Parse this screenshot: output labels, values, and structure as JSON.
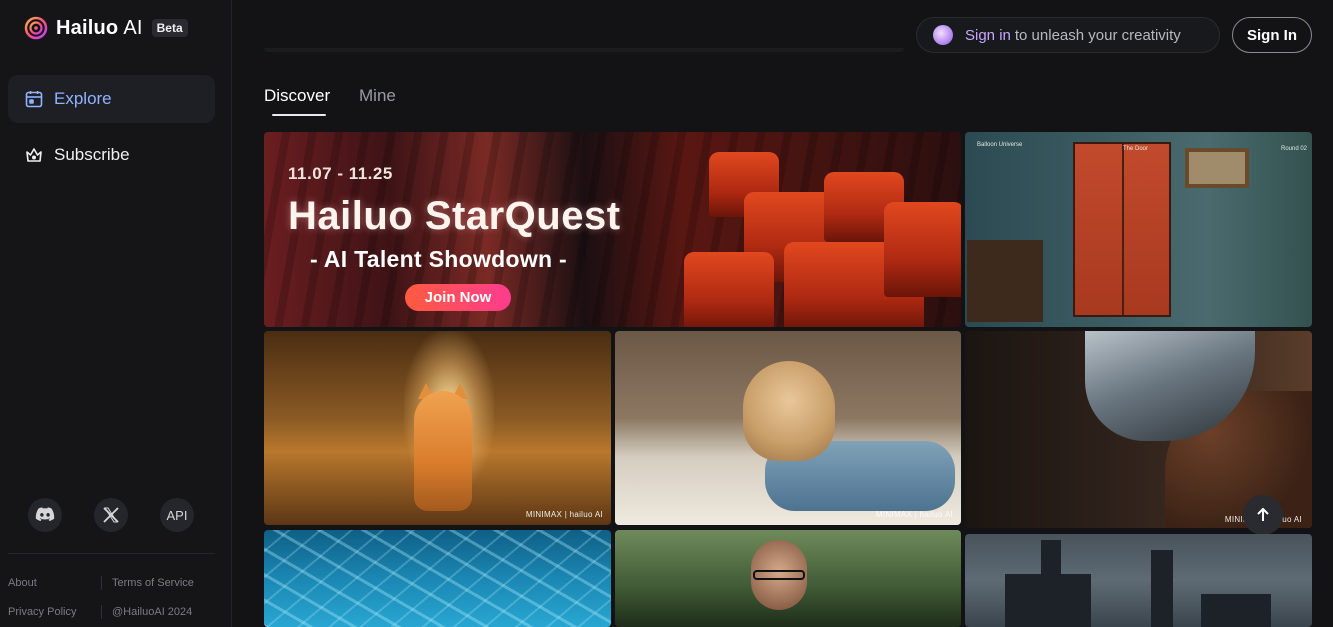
{
  "brand": {
    "name": "Hailuo",
    "suffix": "AI",
    "badge": "Beta"
  },
  "sidebar": {
    "items": [
      {
        "label": "Explore",
        "icon": "calendar-icon",
        "active": true
      },
      {
        "label": "Subscribe",
        "icon": "crown-icon",
        "active": false
      }
    ],
    "social": [
      {
        "name": "discord",
        "icon": "discord-icon"
      },
      {
        "name": "x",
        "icon": "x-icon"
      },
      {
        "name": "api",
        "label": "API"
      }
    ],
    "footer": {
      "about": "About",
      "terms": "Terms of Service",
      "privacy": "Privacy Policy",
      "handle": "@HailuoAI 2024"
    }
  },
  "header": {
    "signin_prompt_accent": "Sign in",
    "signin_prompt_rest": "to unleash your creativity",
    "signin_button": "Sign In"
  },
  "tabs": [
    {
      "label": "Discover",
      "active": true
    },
    {
      "label": "Mine",
      "active": false
    }
  ],
  "banner": {
    "date": "11.07 - 11.25",
    "title": "Hailuo StarQuest",
    "subtitle": "- AI Talent Showdown -",
    "cta": "Join Now"
  },
  "gallery": {
    "watermark": "MINIMAX | hailuo AI",
    "wardrobe_caption_left": "Balloon Universe",
    "wardrobe_caption_mid": "The Door",
    "wardrobe_caption_right": "Round 02"
  },
  "colors": {
    "background": "#131316",
    "active_nav": "#8fb3ff",
    "signin_accent": "#c9a6ff",
    "cta_gradient_start": "#ff5b3f",
    "cta_gradient_end": "#ff3c8e"
  }
}
